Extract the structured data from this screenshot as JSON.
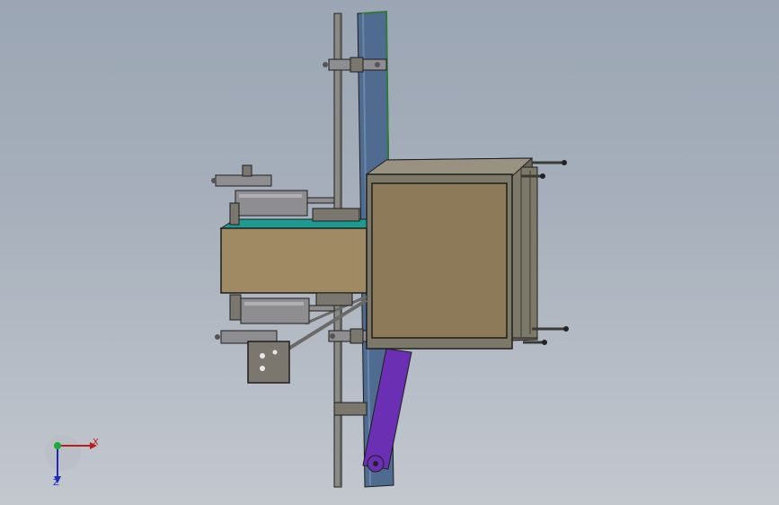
{
  "viewport": {
    "background_top": "#9ba6b4",
    "background_bottom": "#c3c8cf"
  },
  "model": {
    "colors": {
      "outline": "#1e1e1e",
      "box_face": "#8c7a58",
      "box_frame": "#7d7968",
      "beam": "#4f6b8f",
      "beam_edge": "#2f7a3a",
      "conveyor": "#a08a63",
      "belt": "#1d9a92",
      "cylinder": "#8e8e90",
      "arm": "#6a2fb3",
      "bracket": "#7b776e"
    }
  },
  "triad": {
    "x_label": "X",
    "z_label": "Z",
    "x_color": "#b81d1d",
    "z_color": "#1d2bb8",
    "y_color": "#1fa83a"
  }
}
